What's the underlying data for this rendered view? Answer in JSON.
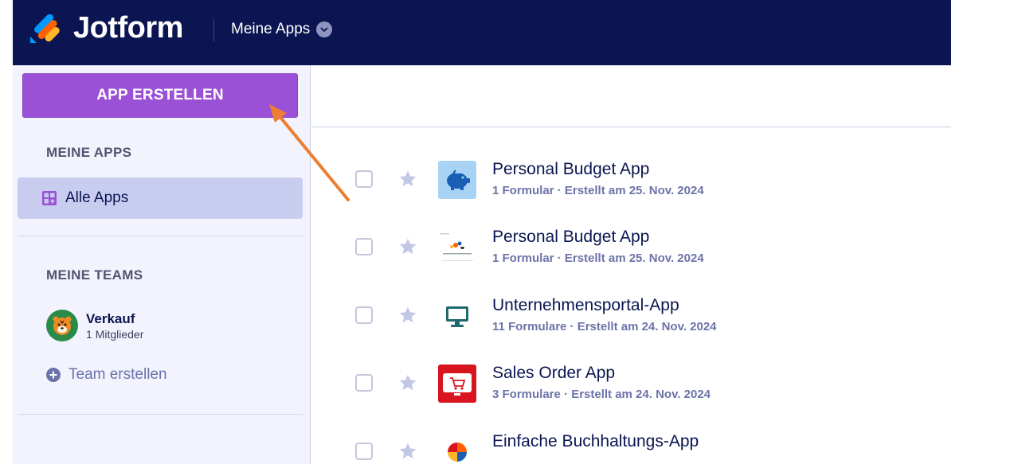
{
  "header": {
    "brand": "Jotform",
    "apps_menu_label": "Meine Apps",
    "colors": {
      "background": "#0a1551",
      "logo_blue": "#0099ff",
      "logo_orange": "#ff6100",
      "logo_yellow": "#ffb629"
    }
  },
  "sidebar": {
    "create_button_label": "APP ERSTELLEN",
    "my_apps_title": "MEINE APPS",
    "all_apps_label": "Alle Apps",
    "my_teams_title": "MEINE TEAMS",
    "team": {
      "name": "Verkauf",
      "members": "1 Mitglieder",
      "avatar_icon": "tiger-icon"
    },
    "create_team_label": "Team erstellen",
    "colors": {
      "create_button": "#9b51d6",
      "active_item": "#c8cdf0"
    }
  },
  "apps": [
    {
      "title": "Personal Budget App",
      "meta": "1 Formular · Erstellt am 25. Nov. 2024",
      "icon": "piggy-bank-icon"
    },
    {
      "title": "Personal Budget App",
      "meta": "1 Formular · Erstellt am 25. Nov. 2024",
      "icon": "app-thumbnail-icon"
    },
    {
      "title": "Unternehmensportal-App",
      "meta": "11 Formulare · Erstellt am 24. Nov. 2024",
      "icon": "monitor-icon"
    },
    {
      "title": "Sales Order App",
      "meta": "3 Formulare · Erstellt am 24. Nov. 2024",
      "icon": "shopping-cart-icon"
    },
    {
      "title": "Einfache Buchhaltungs-App",
      "meta": "",
      "icon": "pie-chart-icon"
    }
  ],
  "annotation": {
    "arrow_color": "#ed7d31"
  }
}
